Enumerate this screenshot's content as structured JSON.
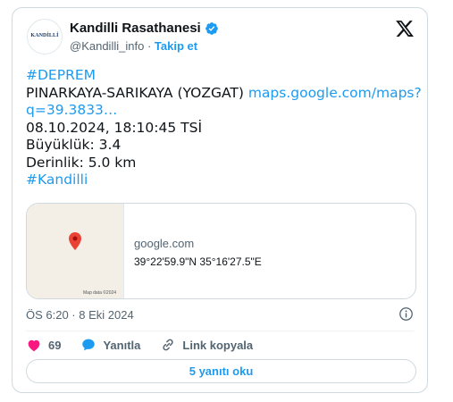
{
  "author": {
    "name": "Kandilli Rasathanesi",
    "handle": "@Kandilli_info",
    "separator": "·",
    "follow_label": "Takip et",
    "avatar_text": "KANDİLLİ"
  },
  "tweet": {
    "lines": [
      "#DEPREM",
      "PINARKAYA-SARIKAYA (YOZGAT)",
      "maps.google.com/maps?",
      "q=39.3833…",
      "08.10.2024, 18:10:45 TSİ",
      "Büyüklük: 3.4",
      "Derinlik: 5.0 km",
      "#Kandilli"
    ]
  },
  "link_card": {
    "domain": "google.com",
    "coordinates": "39°22'59.9\"N 35°16'27.5\"E",
    "map_attribution": "Map data ©2024"
  },
  "meta": {
    "timestamp": "ÖS 6:20 · 8 Eki 2024"
  },
  "actions": {
    "likes_count": "69",
    "reply_label": "Yanıtla",
    "copy_link_label": "Link kopyala"
  },
  "replies_button": "5 yanıtı oku",
  "colors": {
    "accent": "#1d9bf0",
    "like": "#f91880",
    "pin": "#ea4335"
  },
  "icons": [
    "verified-badge-icon",
    "x-logo-icon",
    "map-pin-icon",
    "info-icon",
    "heart-icon",
    "reply-bubble-icon",
    "link-icon"
  ]
}
